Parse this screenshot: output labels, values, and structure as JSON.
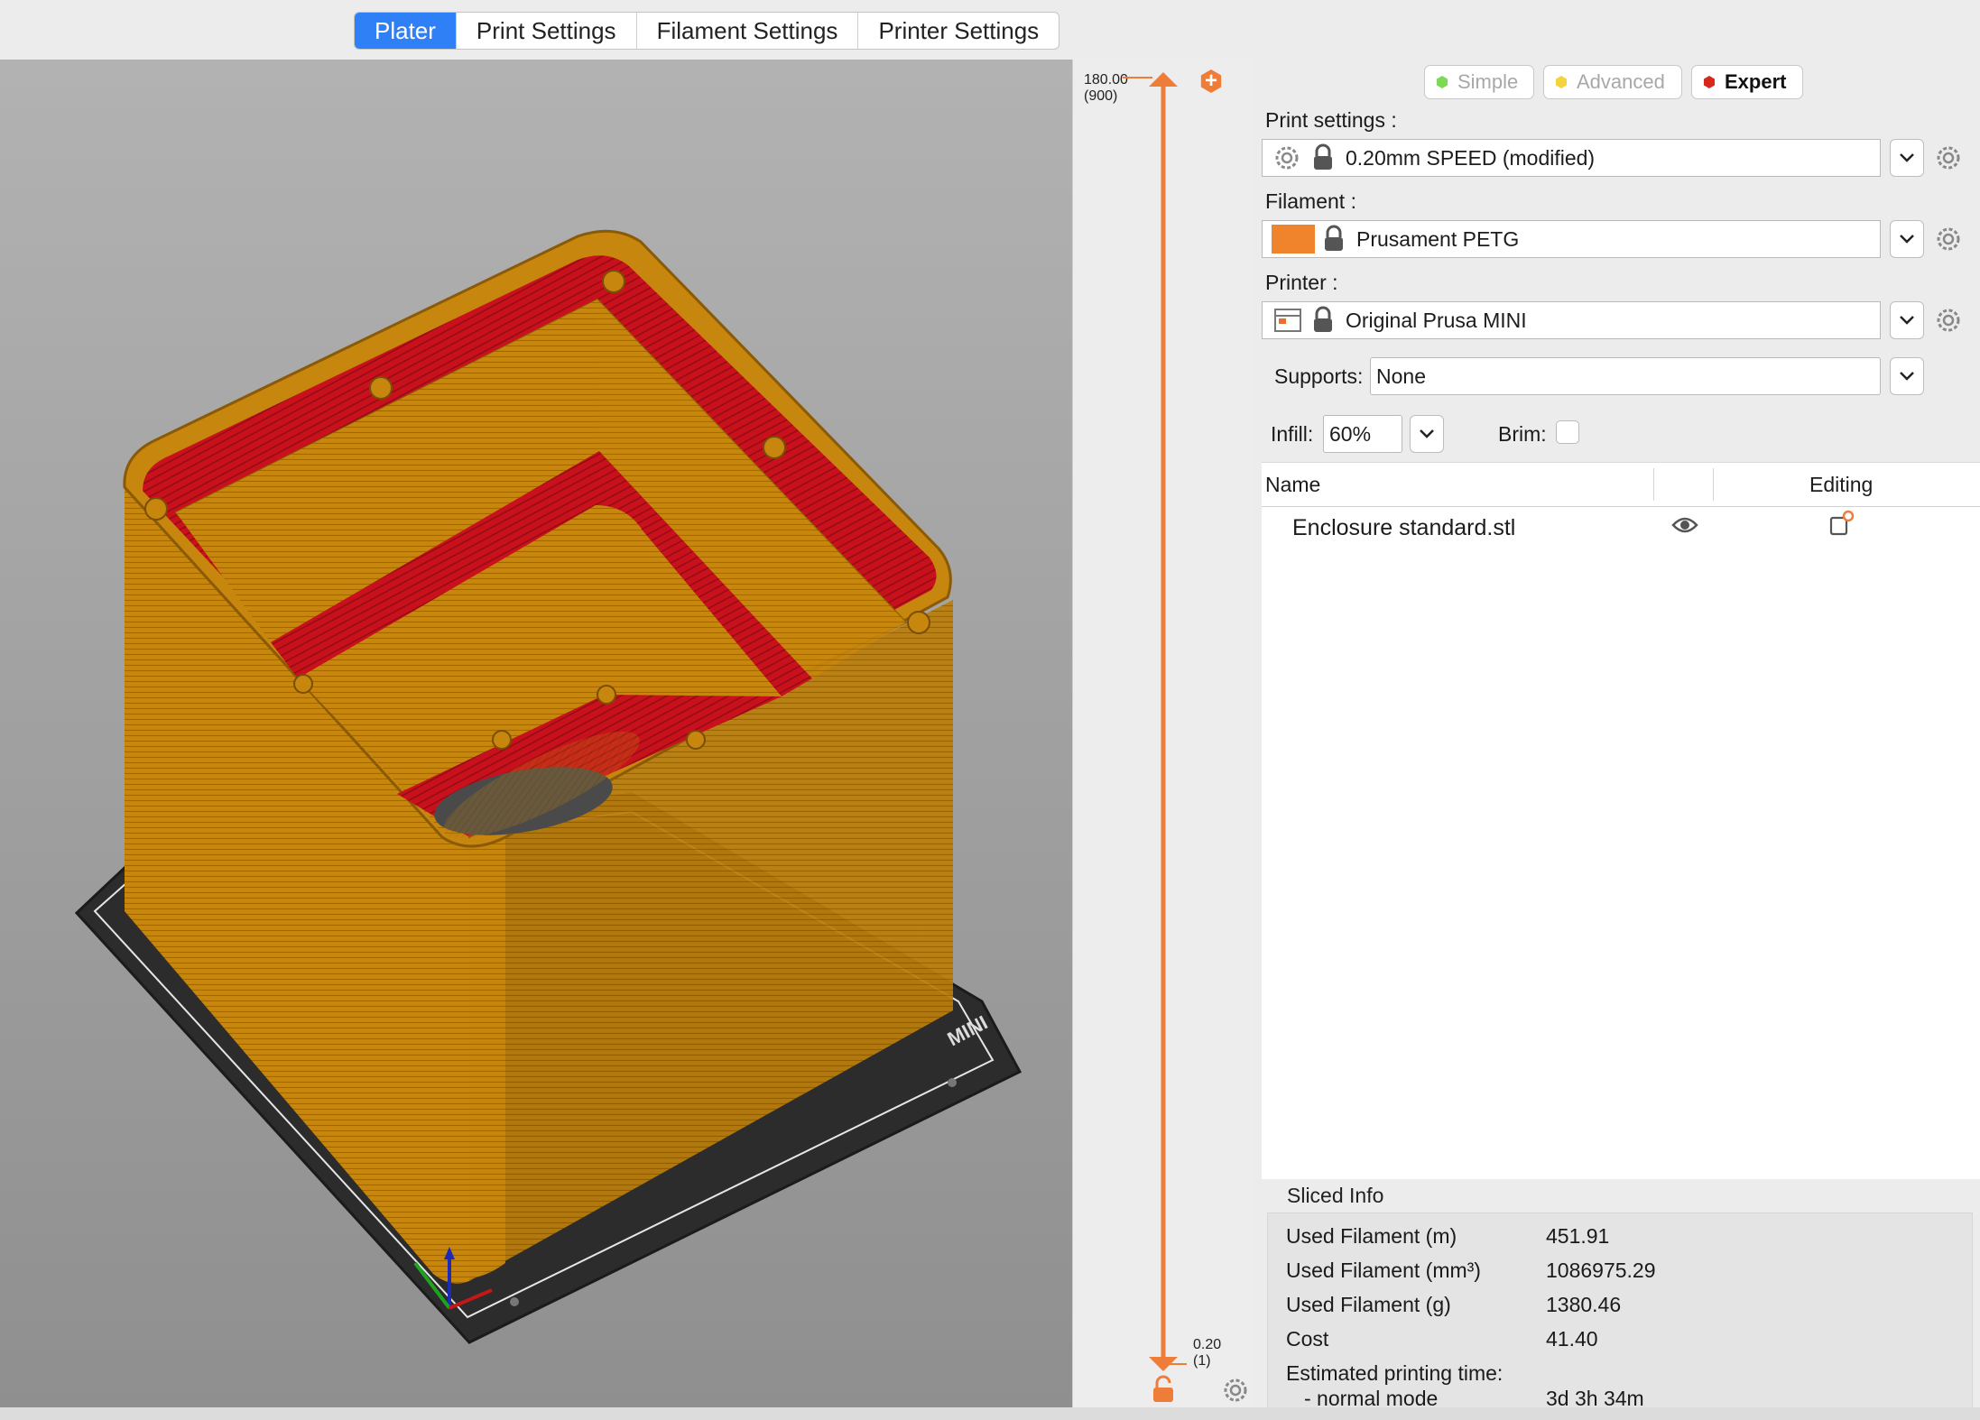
{
  "tabs": [
    "Plater",
    "Print Settings",
    "Filament Settings",
    "Printer Settings"
  ],
  "slider": {
    "top_label": "180.00\n(900)",
    "bottom_label": "0.20\n(1)"
  },
  "modes": {
    "simple": "Simple",
    "advanced": "Advanced",
    "expert": "Expert"
  },
  "colors": {
    "accent": "#2f7ff7",
    "slider": "#ef7d3a",
    "filament": "#f0842d",
    "model": "#c8870e",
    "infill": "#c4101a",
    "simple_dot": "#7ed957",
    "advanced_dot": "#f4d43c",
    "expert_dot": "#d8281e"
  },
  "print_settings": {
    "label": "Print settings :",
    "value": "0.20mm SPEED (modified)"
  },
  "filament": {
    "label": "Filament :",
    "value": "Prusament PETG"
  },
  "printer": {
    "label": "Printer :",
    "value": "Original Prusa MINI"
  },
  "supports": {
    "label": "Supports:",
    "value": "None"
  },
  "infill": {
    "label": "Infill:",
    "value": "60%"
  },
  "brim": {
    "label": "Brim:",
    "checked": false
  },
  "object_list": {
    "columns": {
      "name": "Name",
      "editing": "Editing"
    },
    "rows": [
      {
        "name": "Enclosure standard.stl"
      }
    ]
  },
  "bed_logo": "MINI",
  "sliced_info": {
    "title": "Sliced Info",
    "rows": [
      {
        "label": "Used Filament (m)",
        "value": "451.91"
      },
      {
        "label": "Used Filament (mm³)",
        "value": "1086975.29"
      },
      {
        "label": "Used Filament (g)",
        "value": "1380.46"
      },
      {
        "label": "Cost",
        "value": "41.40"
      },
      {
        "label": "Estimated printing time:",
        "value": ""
      },
      {
        "label": "- normal mode",
        "value": "3d 3h 34m"
      }
    ]
  }
}
